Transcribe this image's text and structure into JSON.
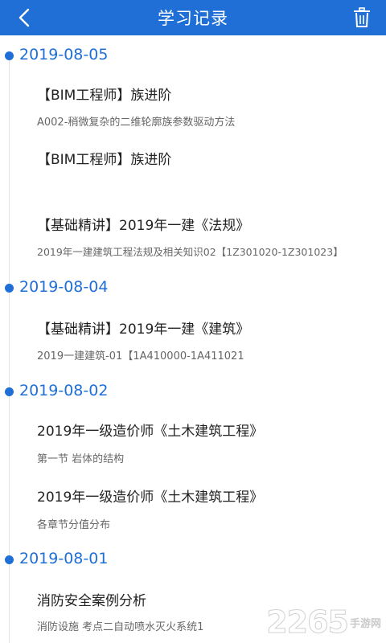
{
  "header": {
    "title": "学习记录",
    "back_icon": "chevron-left-icon",
    "delete_icon": "trash-icon"
  },
  "colors": {
    "primary": "#1f6fd6",
    "text": "#222222",
    "subtext": "#666666"
  },
  "groups": [
    {
      "date": "2019-08-05",
      "items": [
        {
          "title": "【BIM工程师】族进阶",
          "subtitle": "A002-稍微复杂的二维轮廓族参数驱动方法"
        },
        {
          "title": "【BIM工程师】族进阶",
          "subtitle": ""
        },
        {
          "title": "【基础精讲】2019年一建《法规》",
          "subtitle": "2019年一建建筑工程法规及相关知识02【1Z301020-1Z301023】"
        }
      ]
    },
    {
      "date": "2019-08-04",
      "items": [
        {
          "title": "【基础精讲】2019年一建《建筑》",
          "subtitle": "2019一建建筑-01【1A410000-1A411021"
        }
      ]
    },
    {
      "date": "2019-08-02",
      "items": [
        {
          "title": "2019年一级造价师《土木建筑工程》",
          "subtitle": "第一节 岩体的结构"
        },
        {
          "title": "2019年一级造价师《土木建筑工程》",
          "subtitle": "各章节分值分布"
        }
      ]
    },
    {
      "date": "2019-08-01",
      "items": [
        {
          "title": "消防安全案例分析",
          "subtitle": "消防设施 考点二自动喷水灭火系统1"
        }
      ]
    }
  ],
  "watermark": {
    "number": "2265",
    "brand": "手游网"
  }
}
